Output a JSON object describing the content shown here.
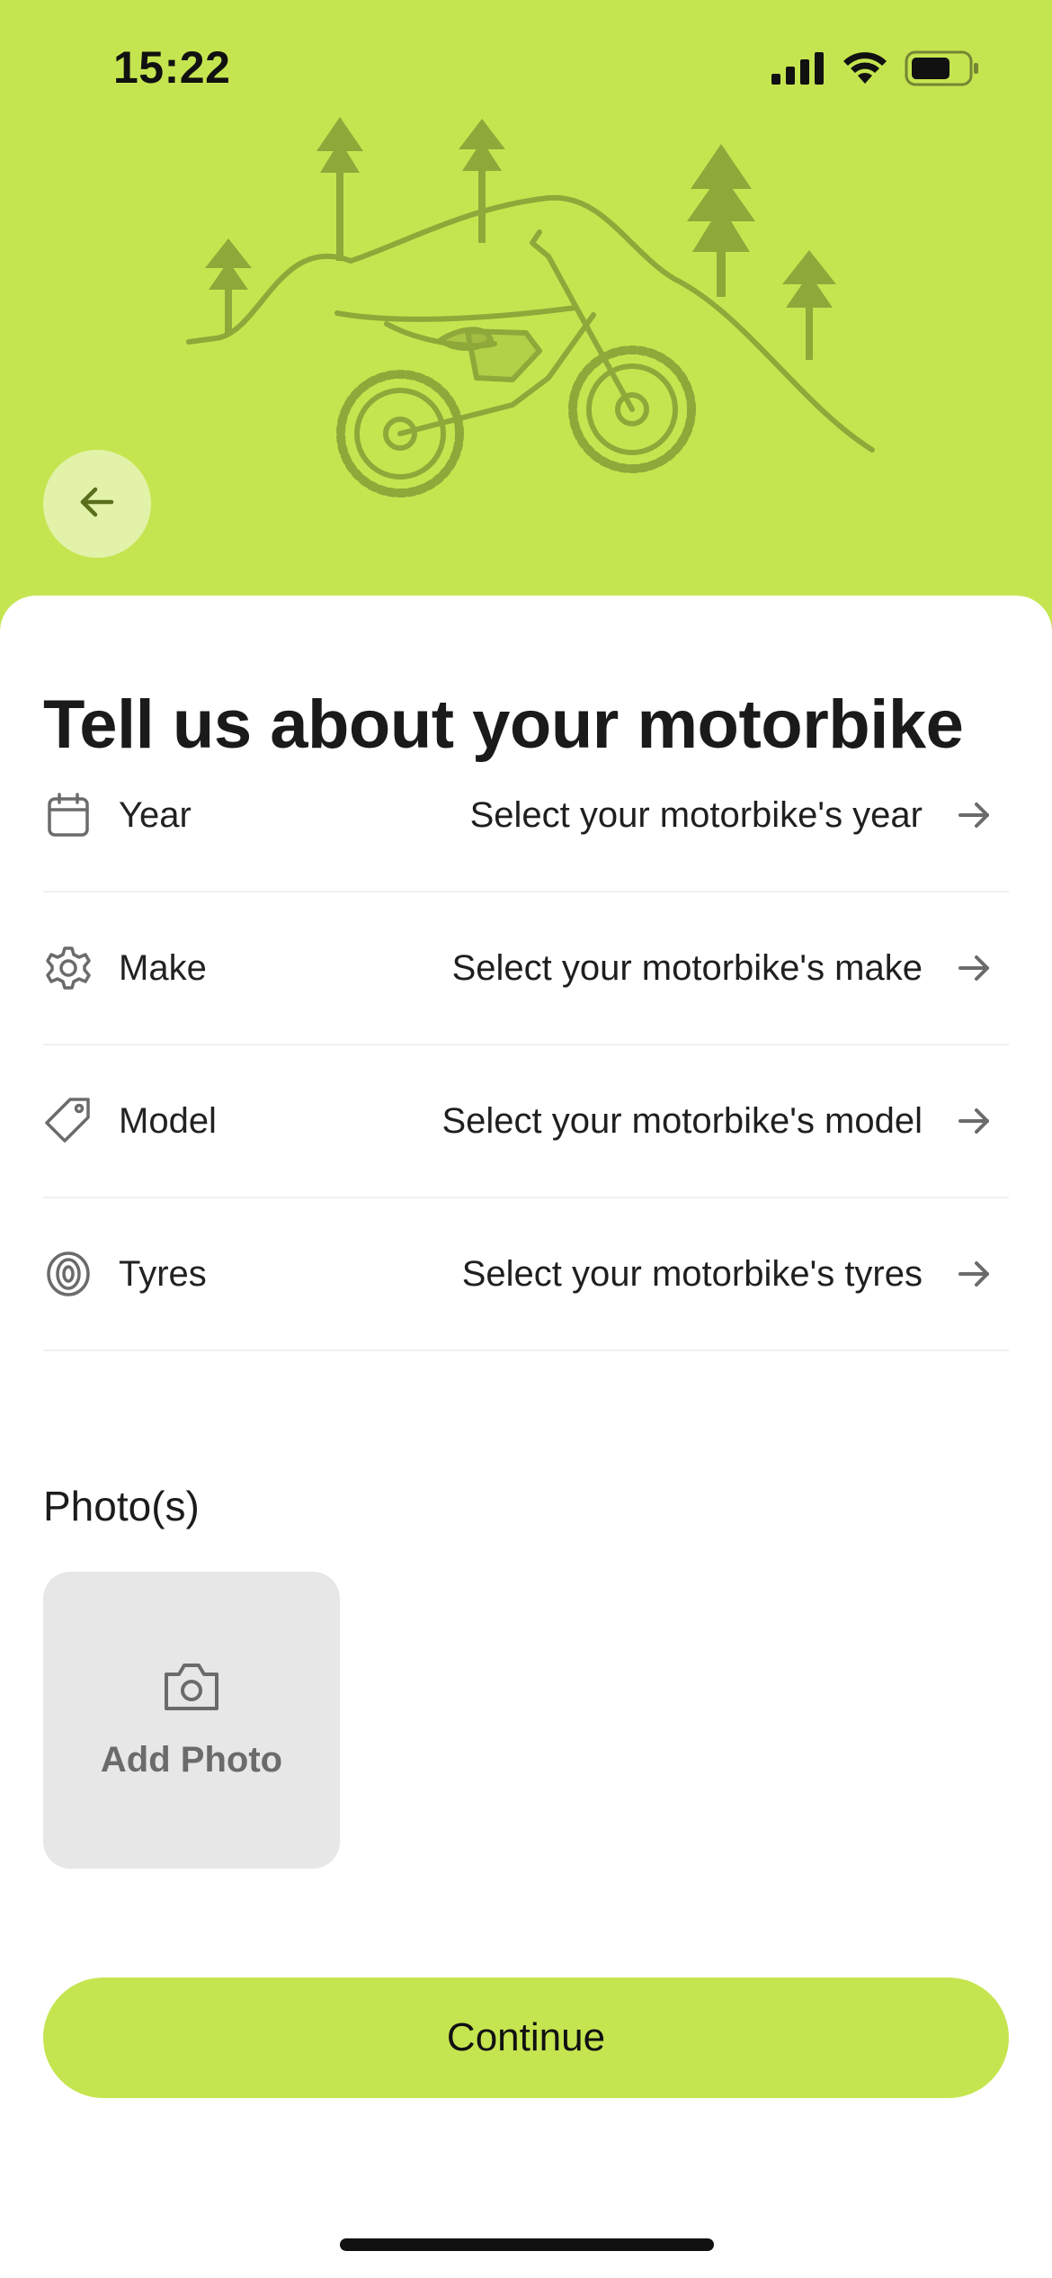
{
  "status_bar": {
    "time": "15:22",
    "battery_level": 0.7
  },
  "header": {
    "back_icon": "arrow-left-icon",
    "illustration": "motorbike-hills-trees"
  },
  "page": {
    "title": "Tell us about your motorbike"
  },
  "fields": [
    {
      "label": "Year",
      "value": "Select your motorbike's year",
      "icon": "calendar-icon"
    },
    {
      "label": "Make",
      "value": "Select your motorbike's make",
      "icon": "gear-icon"
    },
    {
      "label": "Model",
      "value": "Select your motorbike's model",
      "icon": "tag-icon"
    },
    {
      "label": "Tyres",
      "value": "Select your motorbike's tyres",
      "icon": "tyre-icon"
    }
  ],
  "photos": {
    "label": "Photo(s)",
    "add_label": "Add Photo",
    "icon": "camera-icon"
  },
  "actions": {
    "continue_label": "Continue"
  },
  "colors": {
    "accent": "#c5e550",
    "accent_light": "#e2f2a8",
    "illustration": "#8fa83a",
    "text": "#1c1c1e"
  }
}
